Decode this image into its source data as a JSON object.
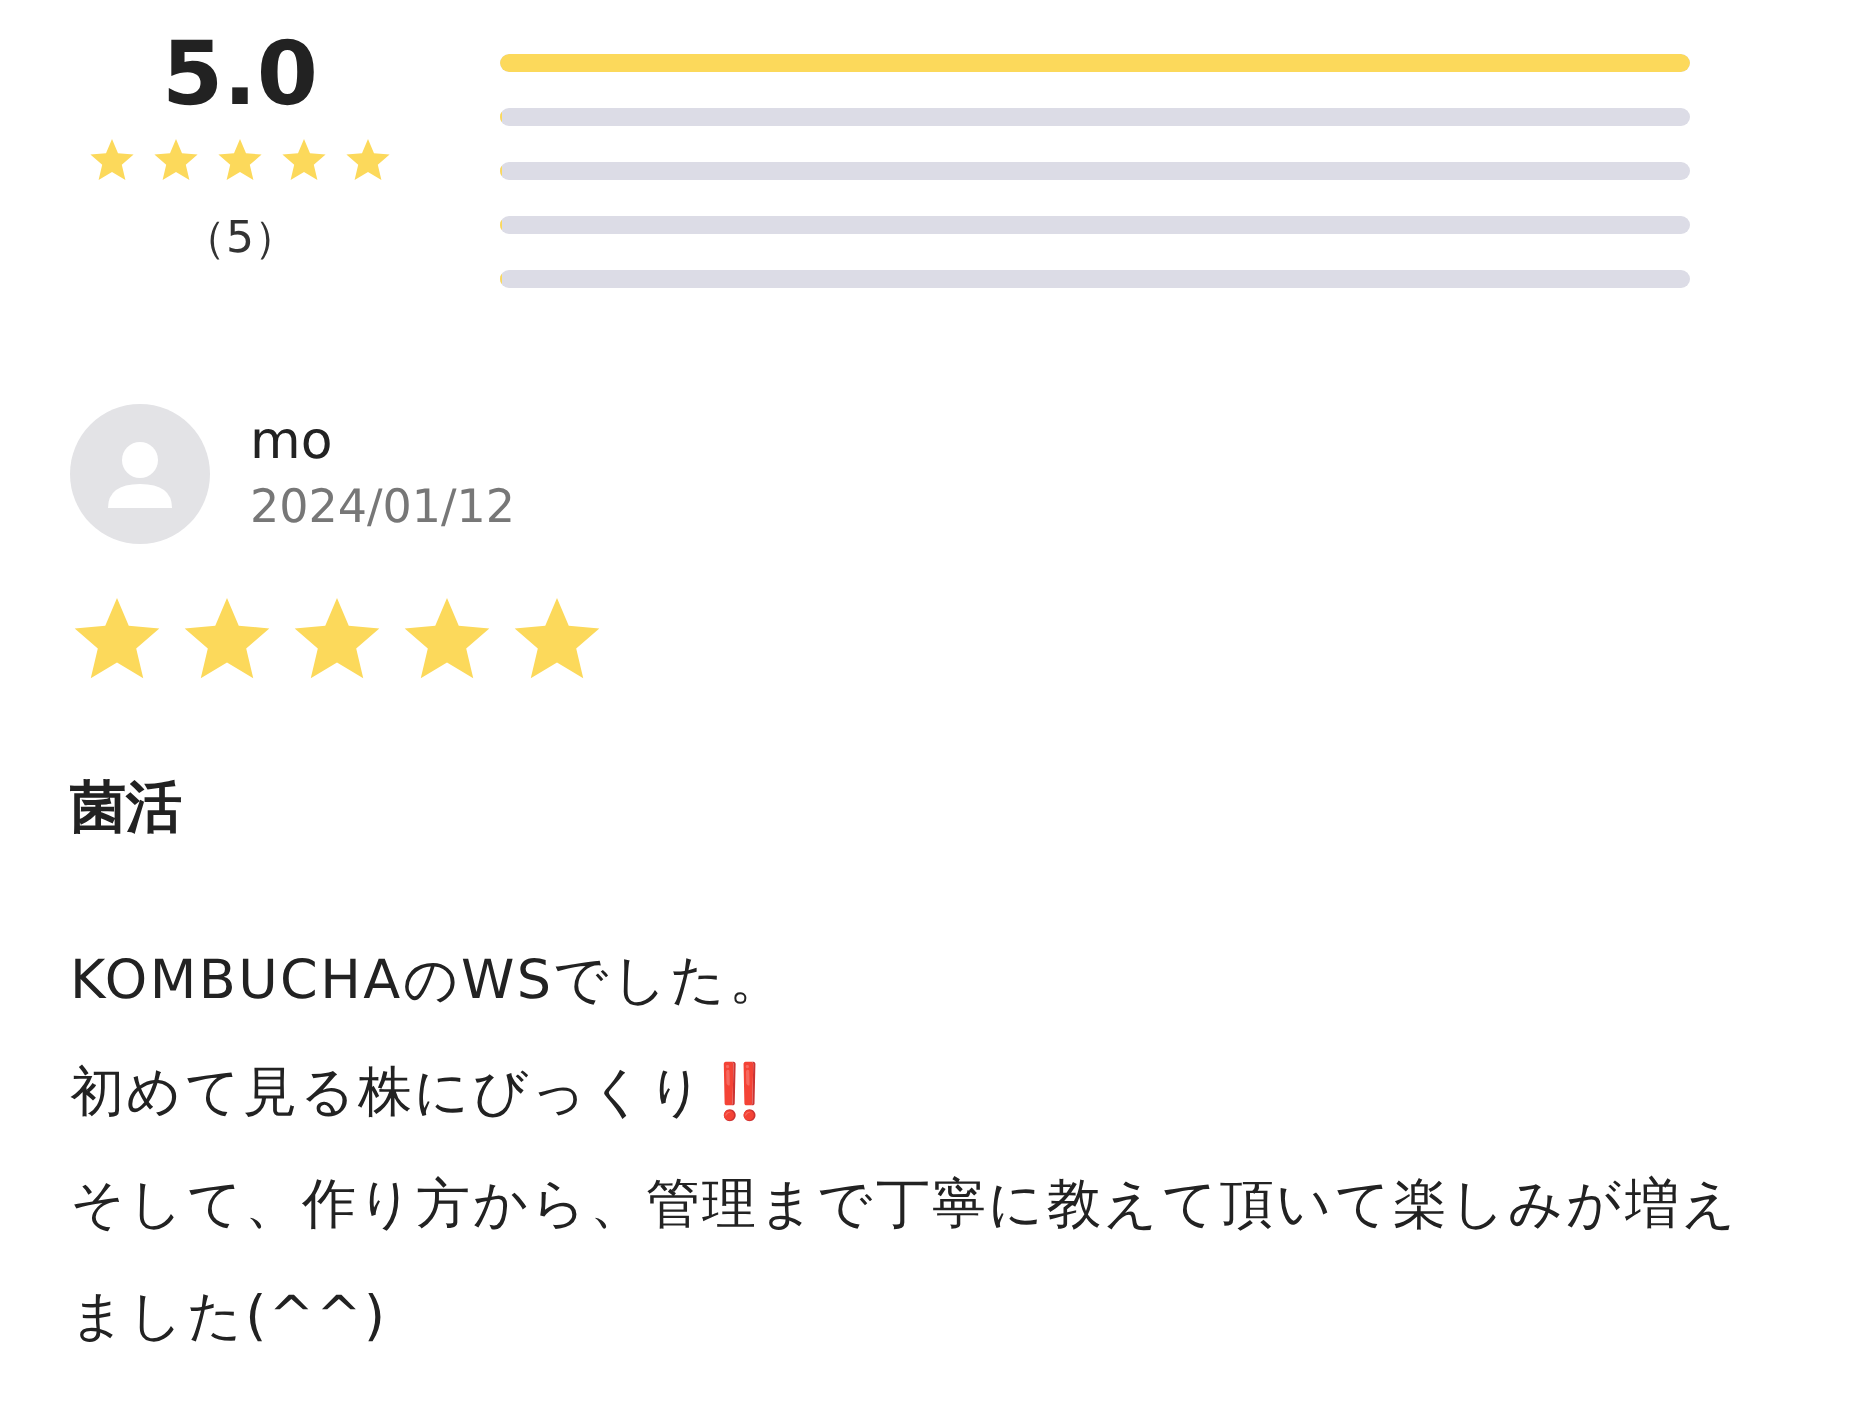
{
  "summary": {
    "score": "5.0",
    "stars": 5,
    "count": "（5）",
    "bars": [
      {
        "level": 1
      },
      {
        "level": 0
      },
      {
        "level": 0
      },
      {
        "level": 0
      },
      {
        "level": 0
      }
    ]
  },
  "review": {
    "name": "mo",
    "date": "2024/01/12",
    "stars": 5,
    "title": "菌活",
    "lines": [
      {
        "text": "KOMBUCHAのWSでした。"
      },
      {
        "text": "初めて見る株にびっくり",
        "emoji": "‼️"
      },
      {
        "text": "そして、作り方から、管理まで丁寧に教えて頂いて楽しみが増えました(^^)"
      }
    ]
  }
}
